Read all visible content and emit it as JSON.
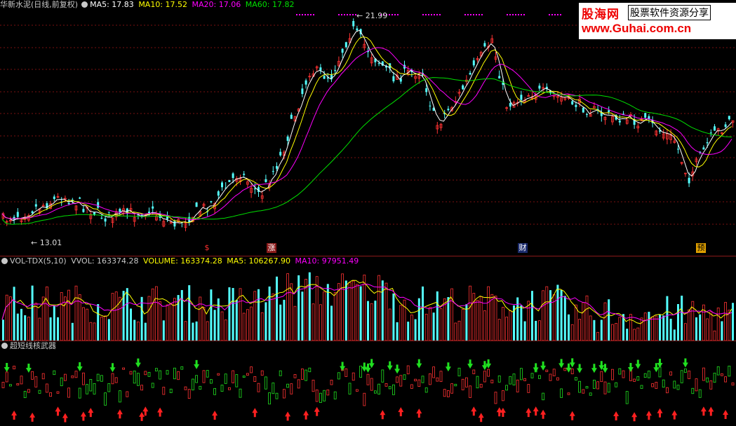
{
  "main": {
    "title": "华新水泥(日线,前复权)",
    "ma5": "MA5: 17.83",
    "ma10": "MA10: 17.52",
    "ma20": "MA20: 17.06",
    "ma60": "MA60: 17.82",
    "high_label": "21.99",
    "low_label": "13.01",
    "markers": [
      "$",
      "涨",
      "财",
      "预"
    ]
  },
  "volume": {
    "title": "VOL-TDX(5,10)",
    "vvol": "VVOL: 163374.28",
    "volume": "VOLUME: 163374.28",
    "ma5": "MA5: 106267.90",
    "ma10": "MA10: 97951.49"
  },
  "indicator": {
    "title": "超短线核武器"
  },
  "logo": {
    "brand": "股海网",
    "tagline": "股票软件资源分享",
    "url": "www.Guhai.com.cn"
  },
  "colors": {
    "up": "#ff3232",
    "down": "#54ffff",
    "ma5": "#ffffff",
    "ma10": "#ffff00",
    "ma20": "#ff00ff",
    "ma60": "#00e000",
    "arrow_up": "#ff2020",
    "arrow_down": "#20e020"
  }
}
